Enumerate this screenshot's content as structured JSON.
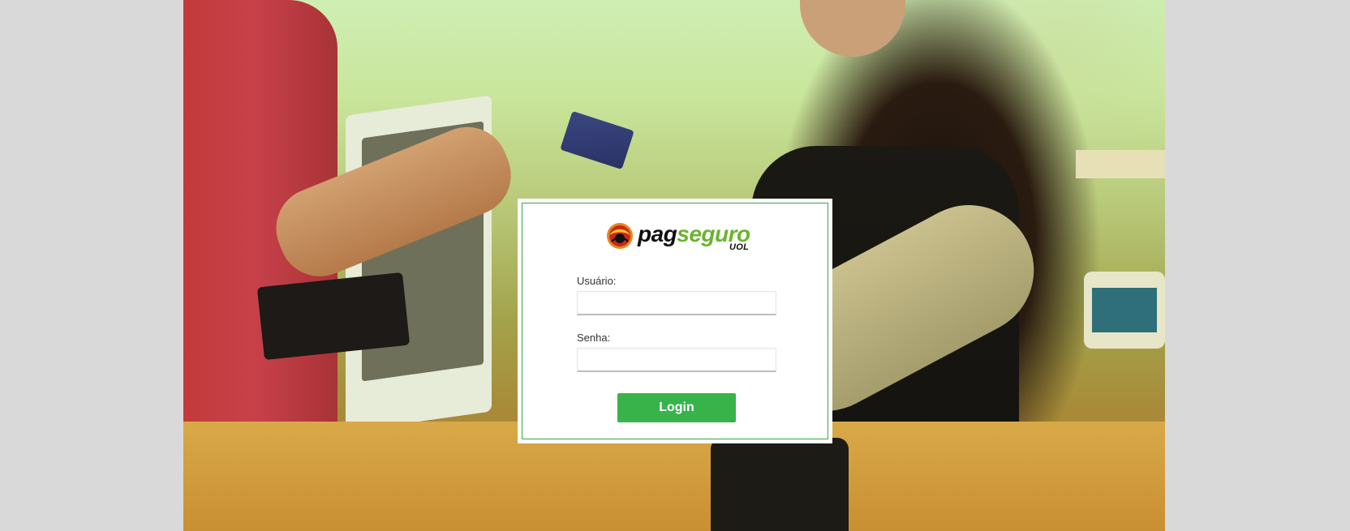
{
  "brand": {
    "name_part1": "pag",
    "name_part2": "seguro",
    "sub": "UOL",
    "colors": {
      "accent": "#37b34a",
      "border": "#3aa54a",
      "seguro": "#6ab42d"
    }
  },
  "form": {
    "user_label": "Usuário:",
    "user_value": "",
    "user_placeholder": "",
    "password_label": "Senha:",
    "password_value": "",
    "password_placeholder": "",
    "submit_label": "Login"
  },
  "icons": {
    "logo": "pagseguro-uol-logo-icon"
  }
}
